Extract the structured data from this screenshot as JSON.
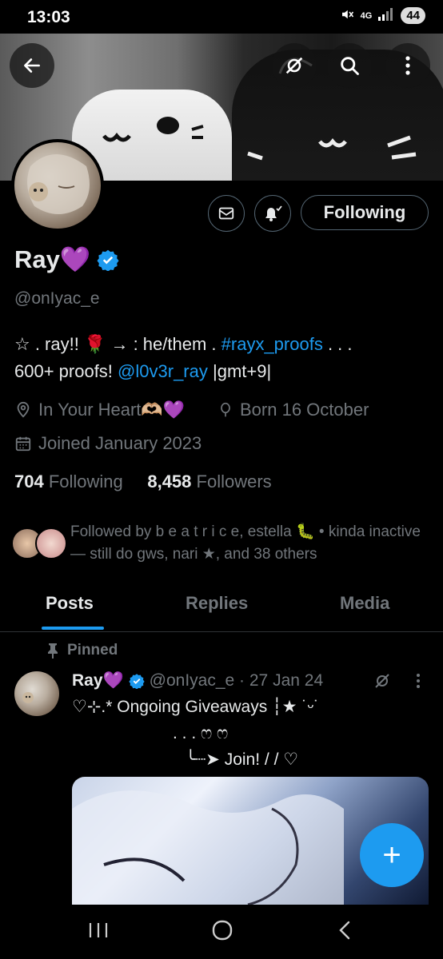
{
  "status_bar": {
    "time": "13:03",
    "network": "4G",
    "battery": "44"
  },
  "profile": {
    "name": "Ray💜",
    "handle": "@onIyac_e",
    "following_button": "Following",
    "bio_line1_a": "☆ . ray!! 🌹 → : he/them . ",
    "bio_hashtag": "#rayx_proofs",
    "bio_line1_b": " . . .",
    "bio_line2_a": "600+ proofs! ",
    "bio_mention": "@l0v3r_ray",
    "bio_line2_b": " |gmt+9|",
    "location": "In Your Heart🫶🏼💜",
    "birthday": "Born 16 October",
    "joined": "Joined January 2023",
    "following_count": "704",
    "following_label": "Following",
    "followers_count": "8,458",
    "followers_label": "Followers",
    "followed_by": "Followed by b e a t r i c e, estella 🐛 • kinda inactive — still do gws, nari ★, and 38 others"
  },
  "tabs": [
    "Posts",
    "Replies",
    "Media"
  ],
  "post": {
    "pinned_label": "Pinned",
    "name": "Ray💜",
    "handle_date": "@onIyac_e · 27 Jan 24",
    "line1": "♡⊹.* Ongoing Giveaways ┆★ ˙ᵕ˙",
    "line2": ". . .  ෆ ෆ",
    "line3": "╰┈➤ Join! / / ♡"
  },
  "fab_label": "+",
  "colors": {
    "accent": "#1d9bf0",
    "muted": "#71767b",
    "text": "#e7e9ea",
    "verified": "#1d9bf0"
  }
}
